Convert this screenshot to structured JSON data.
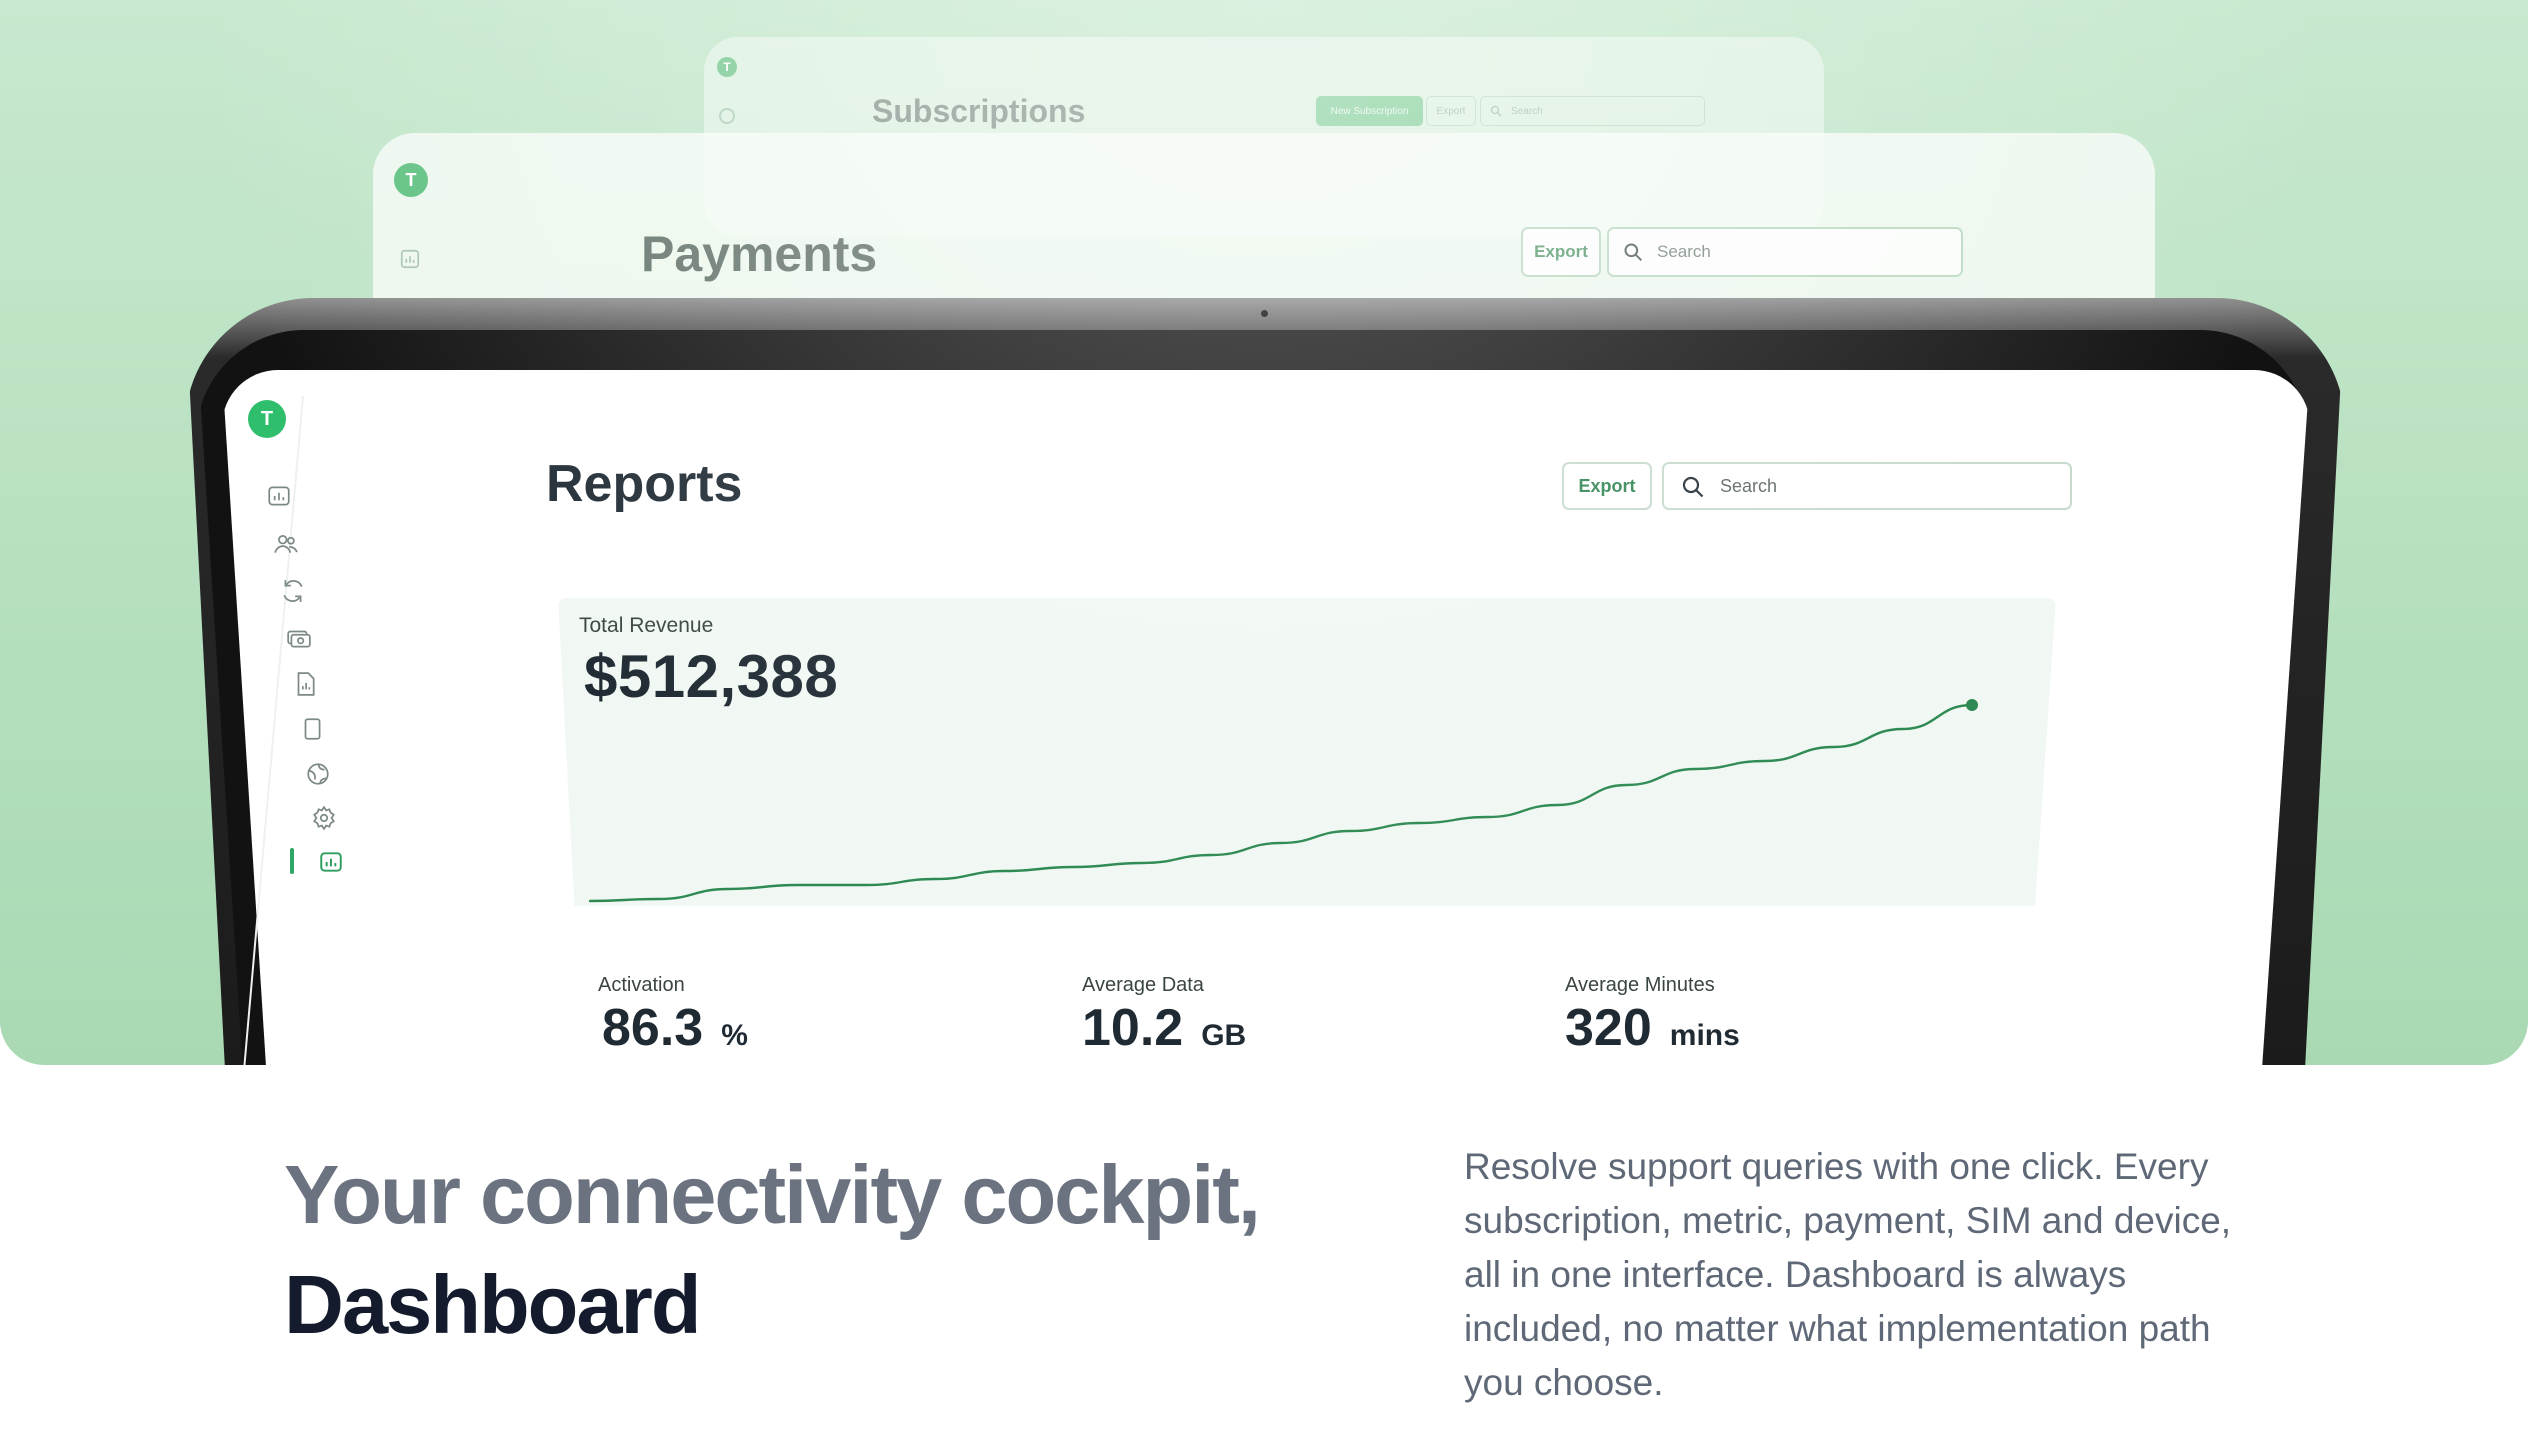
{
  "subscriptions_card": {
    "logo_letter": "T",
    "title": "Subscriptions",
    "new_button": "New Subscription",
    "export_button": "Export",
    "search_placeholder": "Search"
  },
  "payments_card": {
    "logo_letter": "T",
    "title": "Payments",
    "export_button": "Export",
    "search_placeholder": "Search"
  },
  "reports_screen": {
    "logo_letter": "T",
    "title": "Reports",
    "export_button": "Export",
    "search_placeholder": "Search",
    "sidebar_icons": [
      "dashboard-chart-icon",
      "users-icon",
      "refresh-icon",
      "payments-icon",
      "report-file-icon",
      "document-icon",
      "globe-icon",
      "settings-icon",
      "reports-icon"
    ],
    "active_nav": "reports-icon",
    "total_revenue": {
      "label": "Total Revenue",
      "value": "$512,388"
    },
    "metrics": [
      {
        "label": "Activation",
        "value": "86.3",
        "unit": "%"
      },
      {
        "label": "Average Data",
        "value": "10.2",
        "unit": "GB"
      },
      {
        "label": "Average Minutes",
        "value": "320",
        "unit": "mins"
      }
    ]
  },
  "chart_data": {
    "type": "line",
    "title": "",
    "xlabel": "",
    "ylabel": "",
    "grid": false,
    "x": [
      0,
      1,
      2,
      3,
      4,
      5,
      6,
      7,
      8,
      9,
      10,
      11,
      12,
      13,
      14,
      15,
      16,
      17,
      18,
      19,
      20
    ],
    "series": [
      {
        "values": [
          2,
          3,
          8,
          10,
          10,
          13,
          17,
          19,
          21,
          25,
          31,
          37,
          41,
          44,
          50,
          60,
          68,
          72,
          79,
          88,
          100
        ]
      }
    ],
    "ylim": [
      0,
      100
    ],
    "line_color": "#2e8a52",
    "end_marker": true
  },
  "headline": {
    "line1": "Your connectivity cockpit,",
    "line2": "Dashboard"
  },
  "description": "Resolve support queries with one click. Every subscription, metric, payment, SIM and device, all in one interface. Dashboard is always included, no matter what implementation path you choose.",
  "colors": {
    "accent": "#2fbe6c",
    "hero_background": "#b6e0bf",
    "text_dark": "#141b2d",
    "text_muted": "#6b7280"
  }
}
